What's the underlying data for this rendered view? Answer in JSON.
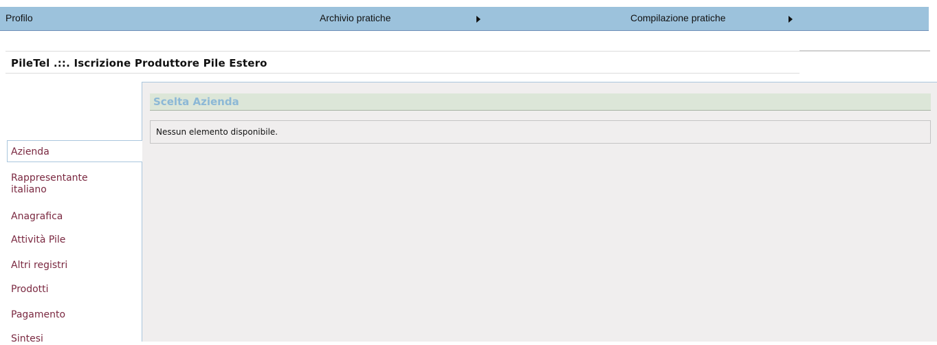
{
  "menu": {
    "profile": "Profilo",
    "archive": "Archivio pratiche",
    "compilation": "Compilazione pratiche"
  },
  "page": {
    "title": "PileTel .::. Iscrizione Produttore Pile Estero"
  },
  "sidebar": {
    "items": [
      {
        "label": "Azienda"
      },
      {
        "label": "Rappresentante italiano"
      },
      {
        "label": "Anagrafica"
      },
      {
        "label": "Attività Pile"
      },
      {
        "label": "Altri registri"
      },
      {
        "label": "Prodotti"
      },
      {
        "label": "Pagamento"
      },
      {
        "label": "Sintesi"
      }
    ]
  },
  "main": {
    "section_title": "Scelta Azienda",
    "empty_message": "Nessun elemento disponibile."
  }
}
